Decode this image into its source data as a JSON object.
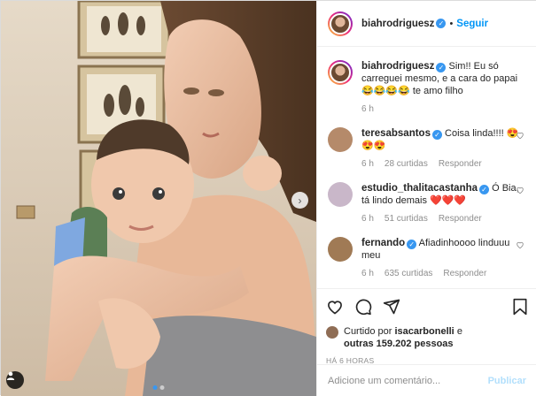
{
  "post": {
    "username": "biahrodriguesz",
    "follow_label": "Seguir",
    "separator": "•",
    "caption": {
      "username": "biahrodriguesz",
      "text": "Sim!! Eu só carreguei mesmo, e a cara do papai 😂😂😂😂 te amo filho",
      "time": "6 h"
    },
    "comments": [
      {
        "username": "teresabsantos",
        "verified": true,
        "text": "Coisa linda!!!! 😍😍😍",
        "time": "6 h",
        "likes": "28 curtidas",
        "reply": "Responder",
        "avatar_color": "#b58a6a"
      },
      {
        "username": "estudio_thalitacastanha",
        "verified": true,
        "text": "Ó Bia, tá lindo demais ❤️❤️❤️",
        "time": "6 h",
        "likes": "51 curtidas",
        "reply": "Responder",
        "avatar_color": "#c9b7c9"
      },
      {
        "username": "fernando",
        "verified": true,
        "text": "Afiadinhoooo linduuu meu",
        "time": "6 h",
        "likes": "635 curtidas",
        "reply": "Responder",
        "avatar_color": "#a07a55"
      }
    ],
    "liked_by": {
      "prefix": "Curtido por",
      "user": "isacarbonelli",
      "middle": "e",
      "others": "outras 159.202 pessoas"
    },
    "timestamp": "HÁ 6 HORAS",
    "comment_input": {
      "placeholder": "Adicione um comentário...",
      "value": ""
    },
    "publish_label": "Publicar",
    "carousel": {
      "total": 2,
      "current": 1
    },
    "colors": {
      "accent": "#0095f6",
      "verified": "#3897f0",
      "heart": "#ed4956"
    }
  }
}
